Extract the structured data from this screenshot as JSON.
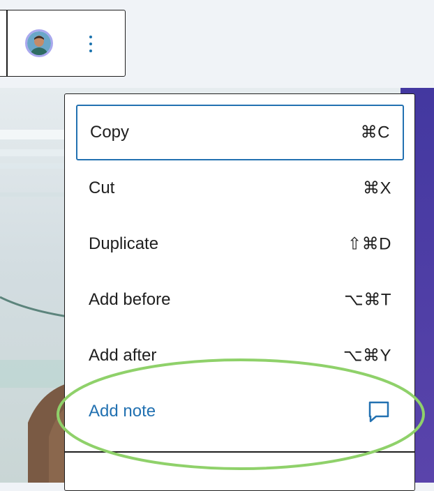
{
  "menu": {
    "items": [
      {
        "label": "Copy",
        "shortcut": "⌘C"
      },
      {
        "label": "Cut",
        "shortcut": "⌘X"
      },
      {
        "label": "Duplicate",
        "shortcut": "⇧⌘D"
      },
      {
        "label": "Add before",
        "shortcut": "⌥⌘T"
      },
      {
        "label": "Add after",
        "shortcut": "⌥⌘Y"
      },
      {
        "label": "Add note",
        "icon": "comment-icon"
      }
    ]
  },
  "toolbar": {
    "avatar": "user-avatar",
    "more_icon": "vertical-ellipsis-icon"
  },
  "colors": {
    "accent": "#2271b1",
    "highlight": "#8fd16a",
    "side_panel": "#4b3ea3",
    "toolbar_bg": "#f0f3f7"
  }
}
